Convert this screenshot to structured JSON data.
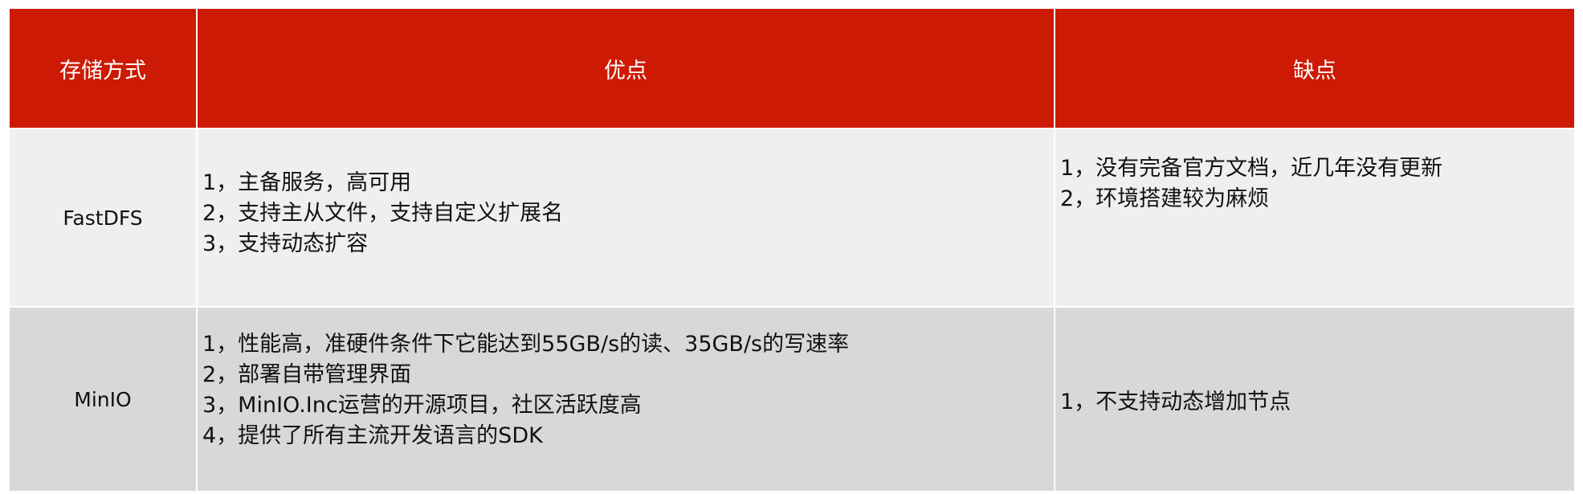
{
  "table": {
    "headers": [
      "存储方式",
      "优点",
      "缺点"
    ],
    "rows": [
      {
        "method": "FastDFS",
        "pros": [
          "1，主备服务，高可用",
          "2，支持主从文件，支持自定义扩展名",
          "3，支持动态扩容"
        ],
        "cons": [
          "1，没有完备官方文档，近几年没有更新",
          "2，环境搭建较为麻烦"
        ]
      },
      {
        "method": "MinIO",
        "pros": [
          "1，性能高，准硬件条件下它能达到55GB/s的读、35GB/s的写速率",
          "2，部署自带管理界面",
          "3，MinIO.Inc运营的开源项目，社区活跃度高",
          "4，提供了所有主流开发语言的SDK"
        ],
        "cons": [
          "1，不支持动态增加节点"
        ]
      }
    ]
  },
  "colors": {
    "header_bg": "#cc1a05",
    "row1_bg": "#efefef",
    "row2_bg": "#d8d8d8"
  }
}
